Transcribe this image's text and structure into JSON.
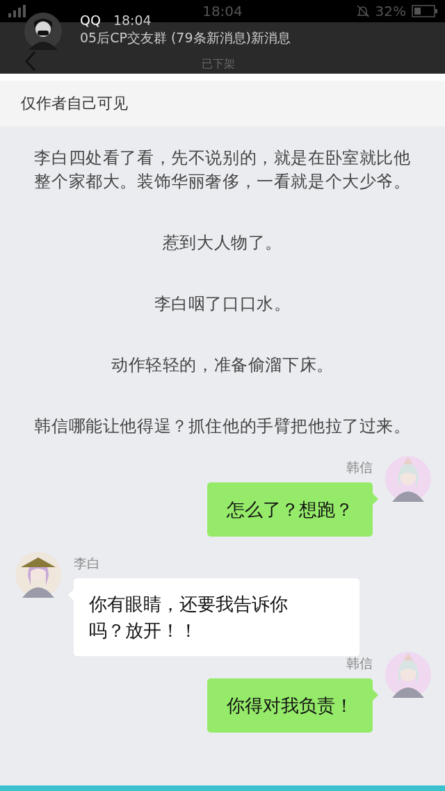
{
  "status_bar": {
    "time": "18:04",
    "battery": "32%"
  },
  "notification": {
    "app": "QQ",
    "time": "18:04",
    "message": "05后CP交友群 (79条新消息)新消息"
  },
  "nav": {
    "subtitle": "已下架"
  },
  "visibility_note": "仅作者自己可见",
  "paragraphs": [
    "李白四处看了看，先不说别的，就是在卧室就比他整个家都大。装饰华丽奢侈，一看就是个大少爷。",
    "惹到大人物了。",
    "李白咽了口口水。",
    "动作轻轻的，准备偷溜下床。",
    "韩信哪能让他得逞？抓住他的手臂把他拉了过来。"
  ],
  "messages": [
    {
      "kind": "sent",
      "sender": "韩信",
      "text": "怎么了？想跑？"
    },
    {
      "kind": "received",
      "sender": "李白",
      "text": "你有眼睛，还要我告诉你吗？放开！！"
    },
    {
      "kind": "sent",
      "sender": "韩信",
      "text": "你得对我负责！"
    }
  ]
}
